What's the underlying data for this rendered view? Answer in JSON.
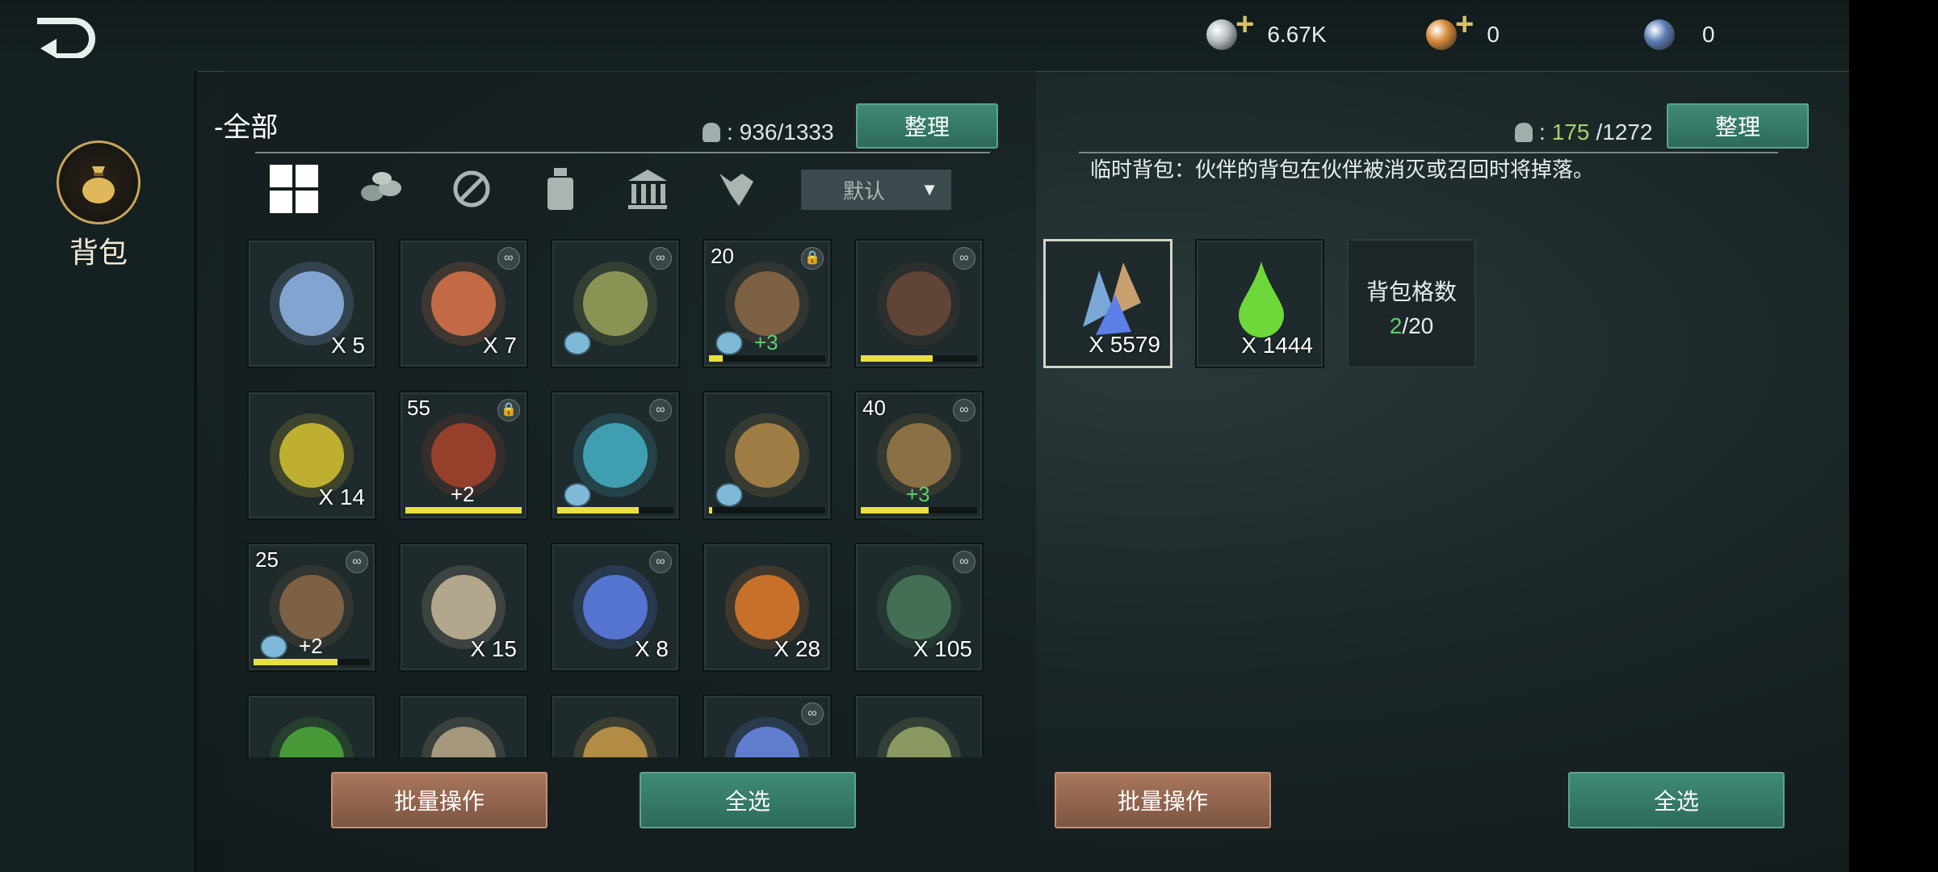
{
  "currencies": [
    {
      "name": "silver-coin-icon",
      "value": "6.67K",
      "has_plus": true,
      "color": "#b8bfc2"
    },
    {
      "name": "gold-coin-icon",
      "value": "0",
      "has_plus": true,
      "color": "#d88a3a"
    },
    {
      "name": "globe-gem-icon",
      "value": "0",
      "has_plus": false,
      "color": "#5d7fb8"
    }
  ],
  "sidebar": {
    "bag_label": "背包"
  },
  "left": {
    "title": "-全部",
    "capacity_sep": ":",
    "capacity": "936/1333",
    "sort_button": "整理",
    "sort_select": "默认",
    "filters": [
      "grid-all-icon",
      "materials-icon",
      "no-weapon-icon",
      "potion-icon",
      "building-icon",
      "creature-icon"
    ],
    "batch_button": "批量操作",
    "select_all_button": "全选"
  },
  "right": {
    "capacity_used": "175",
    "capacity_total": "/1272",
    "capacity_sep": ":",
    "sort_button": "整理",
    "description": "临时背包：伙伴的背包在伙伴被消灭或召回时将掉落。",
    "items": [
      {
        "name": "crystal-shard-item",
        "qty": "X 5579",
        "selected": true
      },
      {
        "name": "green-essence-item",
        "qty": "X 1444",
        "selected": false
      }
    ],
    "slots_label": "背包格数",
    "slots_used": "2",
    "slots_total": "/20",
    "batch_button": "批量操作",
    "select_all_button": "全选"
  },
  "items": [
    {
      "name": "spirit-orb-item",
      "qty": "X 5",
      "lvl": "",
      "bonus": "",
      "link": false,
      "lock": false,
      "shirt": false,
      "bar": null,
      "color": "#8fb6e8"
    },
    {
      "name": "sandwich-item",
      "qty": "X 7",
      "lvl": "",
      "bonus": "",
      "link": true,
      "lock": false,
      "shirt": false,
      "bar": null,
      "color": "#d9734a"
    },
    {
      "name": "green-seed-item",
      "qty": "",
      "lvl": "",
      "bonus": "",
      "link": true,
      "lock": false,
      "shirt": true,
      "bar": null,
      "color": "#9aa35a"
    },
    {
      "name": "wooden-club-item",
      "qty": "",
      "lvl": "20",
      "bonus": "+3",
      "link": false,
      "lock": true,
      "shirt": true,
      "bar": 0.12,
      "color": "#8a6a4a"
    },
    {
      "name": "boots-item",
      "qty": "",
      "lvl": "",
      "bonus": "",
      "link": true,
      "lock": false,
      "shirt": false,
      "bar": 0.62,
      "color": "#6a4a3a"
    },
    {
      "name": "yellow-powder-item",
      "qty": "X 14",
      "lvl": "",
      "bonus": "",
      "link": false,
      "lock": false,
      "shirt": false,
      "bar": null,
      "color": "#d6c233"
    },
    {
      "name": "red-gem-staff-item",
      "qty": "",
      "lvl": "55",
      "bonus": "+2",
      "link": false,
      "lock": true,
      "shirt": false,
      "bar": 1.0,
      "color": "#a8442e"
    },
    {
      "name": "blue-staff-item",
      "qty": "",
      "lvl": "",
      "bonus": "",
      "link": true,
      "lock": false,
      "shirt": true,
      "bar": 0.7,
      "color": "#45b0c4"
    },
    {
      "name": "shovel-item",
      "qty": "",
      "lvl": "",
      "bonus": "",
      "link": false,
      "lock": false,
      "shirt": true,
      "bar": 0.03,
      "color": "#b38a4a"
    },
    {
      "name": "bow-item",
      "qty": "",
      "lvl": "40",
      "bonus": "+3",
      "link": true,
      "lock": false,
      "shirt": false,
      "bar": 0.58,
      "color": "#9a7a4a"
    },
    {
      "name": "trident-item",
      "qty": "",
      "lvl": "25",
      "bonus": "+2",
      "link": true,
      "lock": false,
      "shirt": true,
      "bar": 0.72,
      "color": "#8a6a4a"
    },
    {
      "name": "claw-item",
      "qty": "X 15",
      "lvl": "",
      "bonus": "",
      "link": false,
      "lock": false,
      "shirt": false,
      "bar": null,
      "color": "#c8b89a"
    },
    {
      "name": "blue-crystal-item",
      "qty": "X 8",
      "lvl": "",
      "bonus": "",
      "link": true,
      "lock": false,
      "shirt": false,
      "bar": null,
      "color": "#5d7fe8"
    },
    {
      "name": "fire-seeds-item",
      "qty": "X 28",
      "lvl": "",
      "bonus": "",
      "link": false,
      "lock": false,
      "shirt": false,
      "bar": null,
      "color": "#e07a2a"
    },
    {
      "name": "green-rune-item",
      "qty": "X 105",
      "lvl": "",
      "bonus": "",
      "link": true,
      "lock": false,
      "shirt": false,
      "bar": null,
      "color": "#4a7a5a"
    },
    {
      "name": "green-leaf-item",
      "qty": "",
      "lvl": "",
      "bonus": "",
      "link": false,
      "lock": false,
      "shirt": false,
      "bar": null,
      "color": "#4ea83a"
    },
    {
      "name": "feather-item",
      "qty": "",
      "lvl": "",
      "bonus": "",
      "link": false,
      "lock": false,
      "shirt": false,
      "bar": null,
      "color": "#b8a88a"
    },
    {
      "name": "bread-item",
      "qty": "",
      "lvl": "",
      "bonus": "",
      "link": false,
      "lock": false,
      "shirt": false,
      "bar": null,
      "color": "#c89a4a"
    },
    {
      "name": "ice-crystal-item",
      "qty": "",
      "lvl": "",
      "bonus": "",
      "link": true,
      "lock": false,
      "shirt": false,
      "bar": null,
      "color": "#6a8ae8"
    },
    {
      "name": "potion-item",
      "qty": "",
      "lvl": "",
      "bonus": "",
      "link": false,
      "lock": false,
      "shirt": false,
      "bar": null,
      "color": "#9aa86a"
    }
  ]
}
